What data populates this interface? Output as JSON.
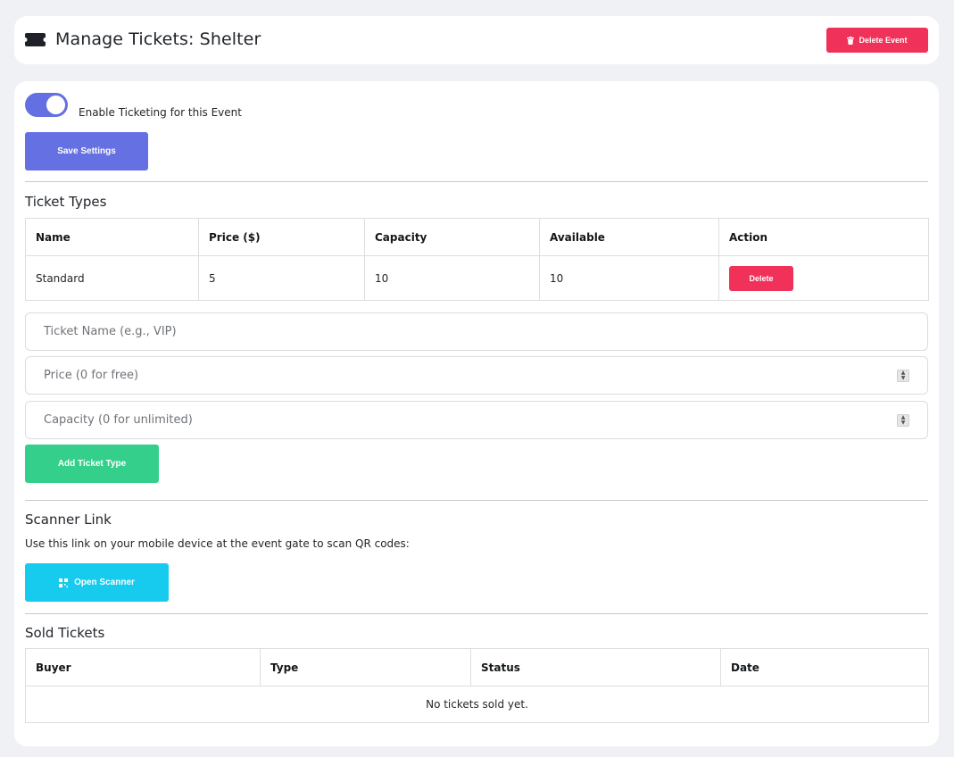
{
  "header": {
    "icon": "ticket-icon",
    "title": "Manage Tickets: Shelter",
    "delete_event_label": "Delete Event",
    "delete_event_icon": "trash-icon"
  },
  "settings": {
    "toggle_enabled": true,
    "toggle_label": "Enable Ticketing for this Event",
    "save_label": "Save Settings"
  },
  "ticket_types": {
    "title": "Ticket Types",
    "columns": [
      "Name",
      "Price ($)",
      "Capacity",
      "Available",
      "Action"
    ],
    "rows": [
      {
        "name": "Standard",
        "price": "5",
        "capacity": "10",
        "available": "10",
        "action_label": "Delete"
      }
    ]
  },
  "add_form": {
    "name_placeholder": "Ticket Name (e.g., VIP)",
    "price_placeholder": "Price (0 for free)",
    "capacity_placeholder": "Capacity (0 for unlimited)",
    "add_label": "Add Ticket Type"
  },
  "scanner": {
    "title": "Scanner Link",
    "description": "Use this link on your mobile device at the event gate to scan QR codes:",
    "open_label": "Open Scanner",
    "open_icon": "qrcode-icon"
  },
  "sold": {
    "title": "Sold Tickets",
    "columns": [
      "Buyer",
      "Type",
      "Status",
      "Date"
    ],
    "empty_message": "No tickets sold yet."
  },
  "colors": {
    "background": "#f0f1f5",
    "primary": "#6571e2",
    "danger": "#f0325a",
    "success": "#33cf8b",
    "info": "#16cbee"
  }
}
